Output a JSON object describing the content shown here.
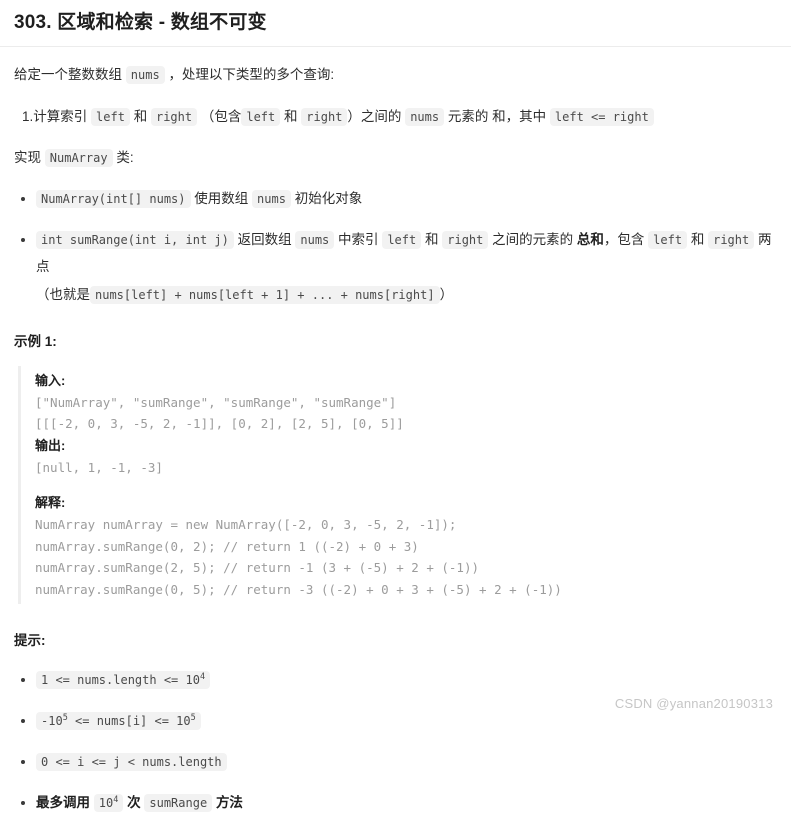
{
  "page": {
    "title": "303. 区域和检索 - 数组不可变",
    "background_color": "#ffffff",
    "text_color": "#2d2d2d",
    "chip_background": "#f2f2f2",
    "chip_text_color": "#4a4a4a",
    "rule_color": "#ececec"
  },
  "intro": {
    "before_code": "给定一个整数数组",
    "code": "nums",
    "after_code": "，处理以下类型的多个查询:"
  },
  "query_item": {
    "number": "1.",
    "t1": "计算索引",
    "c1": "left",
    "t2": "和",
    "c2": "right",
    "t3": "（包含",
    "c3": "left",
    "t4": "和",
    "c4": "right",
    "t5": "）之间的",
    "c5": "nums",
    "t6": "元素的",
    "t7": "和",
    "t8": "，其中",
    "c6": "left <= right"
  },
  "implement": {
    "t1": "实现",
    "code": "NumArray",
    "t2": "类:"
  },
  "methods": [
    {
      "code": "NumArray(int[] nums)",
      "t1": "使用数组",
      "c1": "nums",
      "t2": "初始化对象"
    },
    {
      "code": "int sumRange(int i, int j)",
      "t1": "返回数组",
      "c1": "nums",
      "t2": "中索引",
      "c2": "left",
      "t3": "和",
      "c3": "right",
      "t4": "之间的元素的",
      "strong": "总和",
      "t5": "，包含",
      "c4": "left",
      "t6": "和",
      "c5": "right",
      "t7": "两点",
      "line2_t1": "（也就是",
      "line2_code": "nums[left] + nums[left + 1] + ... + nums[right]",
      "line2_t2": "）"
    }
  ],
  "example": {
    "heading": "示例 1:",
    "input_label": "输入:",
    "input_lines": [
      "[\"NumArray\", \"sumRange\", \"sumRange\", \"sumRange\"]",
      "[[[-2, 0, 3, -5, 2, -1]], [0, 2], [2, 5], [0, 5]]"
    ],
    "output_label": "输出:",
    "output_lines": [
      "[null, 1, -1, -3]"
    ],
    "explain_label": "解释:",
    "explain_lines": [
      "NumArray numArray = new NumArray([-2, 0, 3, -5, 2, -1]);",
      "numArray.sumRange(0, 2); // return 1 ((-2) + 0 + 3)",
      "numArray.sumRange(2, 5); // return -1 (3 + (-5) + 2 + (-1))",
      "numArray.sumRange(0, 5); // return -3 ((-2) + 0 + 3 + (-5) + 2 + (-1))"
    ]
  },
  "hints": {
    "heading": "提示:",
    "items": [
      {
        "type": "code",
        "pre": "1 <= nums.length <= 10",
        "sup": "4",
        "post": ""
      },
      {
        "type": "code",
        "pre": "-10",
        "sup": "5",
        "post": " <= nums[i] <= 10",
        "sup2": "5"
      },
      {
        "type": "code",
        "pre": "0 <= i <= j < nums.length",
        "sup": "",
        "post": ""
      },
      {
        "type": "mixed",
        "t1": "最多调用",
        "c1": "10",
        "c1_sup": "4",
        "t2": "次",
        "c2": "sumRange",
        "t3": "方法"
      }
    ]
  },
  "watermark": {
    "text": "CSDN @yannan20190313"
  }
}
